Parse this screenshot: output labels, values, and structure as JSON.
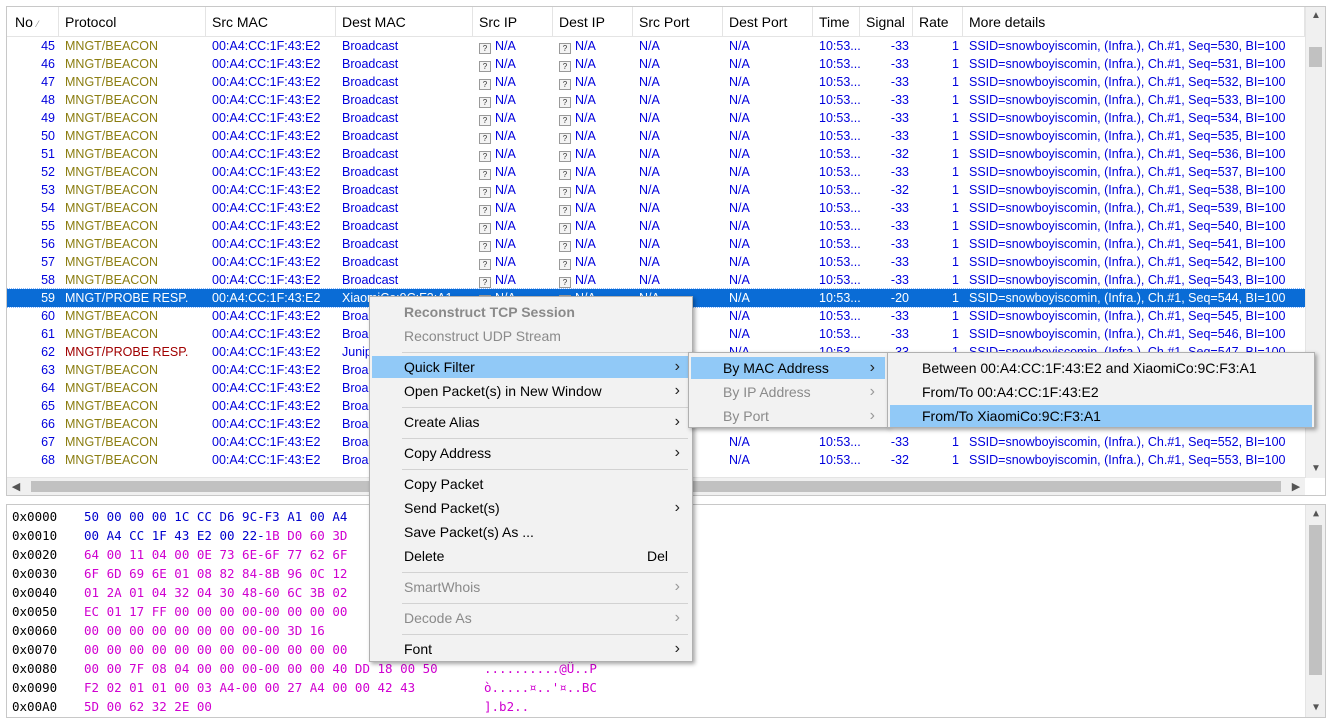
{
  "columns": [
    "No",
    "Protocol",
    "Src MAC",
    "Dest MAC",
    "Src IP",
    "Dest IP",
    "Src Port",
    "Dest Port",
    "Time",
    "Signal",
    "Rate",
    "More details"
  ],
  "rows": [
    {
      "no": "45",
      "protocol": "MNGT/BEACON",
      "src_mac": "00:A4:CC:1F:43:E2",
      "dest_mac": "Broadcast",
      "src_ip": "N/A",
      "dest_ip": "N/A",
      "src_port": "N/A",
      "dest_port": "N/A",
      "time": "10:53...",
      "signal": "-33",
      "rate": "1",
      "details": "SSID=snowboyiscomin, (Infra.), Ch.#1, Seq=530, BI=100"
    },
    {
      "no": "46",
      "protocol": "MNGT/BEACON",
      "src_mac": "00:A4:CC:1F:43:E2",
      "dest_mac": "Broadcast",
      "src_ip": "N/A",
      "dest_ip": "N/A",
      "src_port": "N/A",
      "dest_port": "N/A",
      "time": "10:53...",
      "signal": "-33",
      "rate": "1",
      "details": "SSID=snowboyiscomin, (Infra.), Ch.#1, Seq=531, BI=100"
    },
    {
      "no": "47",
      "protocol": "MNGT/BEACON",
      "src_mac": "00:A4:CC:1F:43:E2",
      "dest_mac": "Broadcast",
      "src_ip": "N/A",
      "dest_ip": "N/A",
      "src_port": "N/A",
      "dest_port": "N/A",
      "time": "10:53...",
      "signal": "-33",
      "rate": "1",
      "details": "SSID=snowboyiscomin, (Infra.), Ch.#1, Seq=532, BI=100"
    },
    {
      "no": "48",
      "protocol": "MNGT/BEACON",
      "src_mac": "00:A4:CC:1F:43:E2",
      "dest_mac": "Broadcast",
      "src_ip": "N/A",
      "dest_ip": "N/A",
      "src_port": "N/A",
      "dest_port": "N/A",
      "time": "10:53...",
      "signal": "-33",
      "rate": "1",
      "details": "SSID=snowboyiscomin, (Infra.), Ch.#1, Seq=533, BI=100"
    },
    {
      "no": "49",
      "protocol": "MNGT/BEACON",
      "src_mac": "00:A4:CC:1F:43:E2",
      "dest_mac": "Broadcast",
      "src_ip": "N/A",
      "dest_ip": "N/A",
      "src_port": "N/A",
      "dest_port": "N/A",
      "time": "10:53...",
      "signal": "-33",
      "rate": "1",
      "details": "SSID=snowboyiscomin, (Infra.), Ch.#1, Seq=534, BI=100"
    },
    {
      "no": "50",
      "protocol": "MNGT/BEACON",
      "src_mac": "00:A4:CC:1F:43:E2",
      "dest_mac": "Broadcast",
      "src_ip": "N/A",
      "dest_ip": "N/A",
      "src_port": "N/A",
      "dest_port": "N/A",
      "time": "10:53...",
      "signal": "-33",
      "rate": "1",
      "details": "SSID=snowboyiscomin, (Infra.), Ch.#1, Seq=535, BI=100"
    },
    {
      "no": "51",
      "protocol": "MNGT/BEACON",
      "src_mac": "00:A4:CC:1F:43:E2",
      "dest_mac": "Broadcast",
      "src_ip": "N/A",
      "dest_ip": "N/A",
      "src_port": "N/A",
      "dest_port": "N/A",
      "time": "10:53...",
      "signal": "-32",
      "rate": "1",
      "details": "SSID=snowboyiscomin, (Infra.), Ch.#1, Seq=536, BI=100"
    },
    {
      "no": "52",
      "protocol": "MNGT/BEACON",
      "src_mac": "00:A4:CC:1F:43:E2",
      "dest_mac": "Broadcast",
      "src_ip": "N/A",
      "dest_ip": "N/A",
      "src_port": "N/A",
      "dest_port": "N/A",
      "time": "10:53...",
      "signal": "-33",
      "rate": "1",
      "details": "SSID=snowboyiscomin, (Infra.), Ch.#1, Seq=537, BI=100"
    },
    {
      "no": "53",
      "protocol": "MNGT/BEACON",
      "src_mac": "00:A4:CC:1F:43:E2",
      "dest_mac": "Broadcast",
      "src_ip": "N/A",
      "dest_ip": "N/A",
      "src_port": "N/A",
      "dest_port": "N/A",
      "time": "10:53...",
      "signal": "-32",
      "rate": "1",
      "details": "SSID=snowboyiscomin, (Infra.), Ch.#1, Seq=538, BI=100"
    },
    {
      "no": "54",
      "protocol": "MNGT/BEACON",
      "src_mac": "00:A4:CC:1F:43:E2",
      "dest_mac": "Broadcast",
      "src_ip": "N/A",
      "dest_ip": "N/A",
      "src_port": "N/A",
      "dest_port": "N/A",
      "time": "10:53...",
      "signal": "-33",
      "rate": "1",
      "details": "SSID=snowboyiscomin, (Infra.), Ch.#1, Seq=539, BI=100"
    },
    {
      "no": "55",
      "protocol": "MNGT/BEACON",
      "src_mac": "00:A4:CC:1F:43:E2",
      "dest_mac": "Broadcast",
      "src_ip": "N/A",
      "dest_ip": "N/A",
      "src_port": "N/A",
      "dest_port": "N/A",
      "time": "10:53...",
      "signal": "-33",
      "rate": "1",
      "details": "SSID=snowboyiscomin, (Infra.), Ch.#1, Seq=540, BI=100"
    },
    {
      "no": "56",
      "protocol": "MNGT/BEACON",
      "src_mac": "00:A4:CC:1F:43:E2",
      "dest_mac": "Broadcast",
      "src_ip": "N/A",
      "dest_ip": "N/A",
      "src_port": "N/A",
      "dest_port": "N/A",
      "time": "10:53...",
      "signal": "-33",
      "rate": "1",
      "details": "SSID=snowboyiscomin, (Infra.), Ch.#1, Seq=541, BI=100"
    },
    {
      "no": "57",
      "protocol": "MNGT/BEACON",
      "src_mac": "00:A4:CC:1F:43:E2",
      "dest_mac": "Broadcast",
      "src_ip": "N/A",
      "dest_ip": "N/A",
      "src_port": "N/A",
      "dest_port": "N/A",
      "time": "10:53...",
      "signal": "-33",
      "rate": "1",
      "details": "SSID=snowboyiscomin, (Infra.), Ch.#1, Seq=542, BI=100"
    },
    {
      "no": "58",
      "protocol": "MNGT/BEACON",
      "src_mac": "00:A4:CC:1F:43:E2",
      "dest_mac": "Broadcast",
      "src_ip": "N/A",
      "dest_ip": "N/A",
      "src_port": "N/A",
      "dest_port": "N/A",
      "time": "10:53...",
      "signal": "-33",
      "rate": "1",
      "details": "SSID=snowboyiscomin, (Infra.), Ch.#1, Seq=543, BI=100"
    },
    {
      "no": "59",
      "protocol": "MNGT/PROBE RESP.",
      "src_mac": "00:A4:CC:1F:43:E2",
      "dest_mac": "XiaomiCo:9C:F3:A1",
      "src_ip": "N/A",
      "dest_ip": "N/A",
      "src_port": "N/A",
      "dest_port": "N/A",
      "time": "10:53...",
      "signal": "-20",
      "rate": "1",
      "details": "SSID=snowboyiscomin, (Infra.), Ch.#1, Seq=544, BI=100",
      "selected": true,
      "probe": true
    },
    {
      "no": "60",
      "protocol": "MNGT/BEACON",
      "src_mac": "00:A4:CC:1F:43:E2",
      "dest_mac": "Broa",
      "src_ip": "",
      "dest_ip": "",
      "src_port": "",
      "dest_port": "N/A",
      "time": "10:53...",
      "signal": "-33",
      "rate": "1",
      "details": "SSID=snowboyiscomin, (Infra.), Ch.#1, Seq=545, BI=100"
    },
    {
      "no": "61",
      "protocol": "MNGT/BEACON",
      "src_mac": "00:A4:CC:1F:43:E2",
      "dest_mac": "Broa",
      "src_ip": "",
      "dest_ip": "",
      "src_port": "",
      "dest_port": "N/A",
      "time": "10:53...",
      "signal": "-33",
      "rate": "1",
      "details": "SSID=snowboyiscomin, (Infra.), Ch.#1, Seq=546, BI=100"
    },
    {
      "no": "62",
      "protocol": "MNGT/PROBE RESP.",
      "src_mac": "00:A4:CC:1F:43:E2",
      "dest_mac": "Junip",
      "src_ip": "",
      "dest_ip": "",
      "src_port": "",
      "dest_port": "N/A",
      "time": "10:53...",
      "signal": "-33",
      "rate": "1",
      "details": "SSID=snowboyiscomin, (Infra.), Ch.#1, Seq=547, BI=100",
      "probe": true
    },
    {
      "no": "63",
      "protocol": "MNGT/BEACON",
      "src_mac": "00:A4:CC:1F:43:E2",
      "dest_mac": "Broa",
      "src_ip": "",
      "dest_ip": "",
      "src_port": "",
      "dest_port": "",
      "time": "",
      "signal": "",
      "rate": "",
      "details": ""
    },
    {
      "no": "64",
      "protocol": "MNGT/BEACON",
      "src_mac": "00:A4:CC:1F:43:E2",
      "dest_mac": "Broa",
      "src_ip": "",
      "dest_ip": "",
      "src_port": "",
      "dest_port": "",
      "time": "",
      "signal": "",
      "rate": "",
      "details": ""
    },
    {
      "no": "65",
      "protocol": "MNGT/BEACON",
      "src_mac": "00:A4:CC:1F:43:E2",
      "dest_mac": "Broa",
      "src_ip": "",
      "dest_ip": "",
      "src_port": "",
      "dest_port": "",
      "time": "",
      "signal": "",
      "rate": "",
      "details": ""
    },
    {
      "no": "66",
      "protocol": "MNGT/BEACON",
      "src_mac": "00:A4:CC:1F:43:E2",
      "dest_mac": "Broa",
      "src_ip": "",
      "dest_ip": "",
      "src_port": "",
      "dest_port": "",
      "time": "",
      "signal": "",
      "rate": "",
      "details": ""
    },
    {
      "no": "67",
      "protocol": "MNGT/BEACON",
      "src_mac": "00:A4:CC:1F:43:E2",
      "dest_mac": "Broa",
      "src_ip": "",
      "dest_ip": "",
      "src_port": "",
      "dest_port": "N/A",
      "time": "10:53...",
      "signal": "-33",
      "rate": "1",
      "details": "SSID=snowboyiscomin, (Infra.), Ch.#1, Seq=552, BI=100"
    },
    {
      "no": "68",
      "protocol": "MNGT/BEACON",
      "src_mac": "00:A4:CC:1F:43:E2",
      "dest_mac": "Broa",
      "src_ip": "",
      "dest_ip": "",
      "src_port": "",
      "dest_port": "N/A",
      "time": "10:53...",
      "signal": "-32",
      "rate": "1",
      "details": "SSID=snowboyiscomin, (Infra.), Ch.#1, Seq=553, BI=100"
    }
  ],
  "hex_dump": [
    {
      "offset": "0x0000",
      "bytes": [
        [
          "b",
          "50 00 00 00 1C CC D6 9C-F3 A1 00 A4"
        ]
      ],
      "ascii": ""
    },
    {
      "offset": "0x0010",
      "bytes": [
        [
          "b",
          "00 A4 CC 1F 43 E2 00 22-"
        ],
        [
          "m",
          "1B D0 60 3D"
        ]
      ],
      "ascii": ""
    },
    {
      "offset": "0x0020",
      "bytes": [
        [
          "m",
          "64 00 11 04 00 0E 73 6E-6F 77 62 6F"
        ]
      ],
      "ascii": ""
    },
    {
      "offset": "0x0030",
      "bytes": [
        [
          "m",
          "6F 6D 69 6E 01 08 82 84-8B 96 0C 12"
        ]
      ],
      "ascii": ""
    },
    {
      "offset": "0x0040",
      "bytes": [
        [
          "m",
          "01 2A 01 04 32 04 30 48-60 6C 3B 02"
        ]
      ],
      "ascii": ""
    },
    {
      "offset": "0x0050",
      "bytes": [
        [
          "m",
          "EC 01 17 FF 00 00 00 00-00 00 00 00"
        ]
      ],
      "ascii": ""
    },
    {
      "offset": "0x0060",
      "bytes": [
        [
          "m",
          "00 00 00 00 00 00 00 00-00 3D 16"
        ]
      ],
      "ascii": ""
    },
    {
      "offset": "0x0070",
      "bytes": [
        [
          "m",
          "00 00 00 00 00 00 00 00-00 00 00 00"
        ]
      ],
      "ascii": ""
    },
    {
      "offset": "0x0080",
      "bytes": [
        [
          "m",
          "00 00 7F 08 04 00 00 00-00 00 00 40 DD 18 00 50"
        ]
      ],
      "ascii": "..........@Ü..P"
    },
    {
      "offset": "0x0090",
      "bytes": [
        [
          "m",
          "F2 02 01 01 00 03 A4-00 00 27 A4 00 00 42 43"
        ]
      ],
      "ascii": "ò.....¤..'¤..BC"
    },
    {
      "offset": "0x00A0",
      "bytes": [
        [
          "m",
          "5D 00 62 32 2E 00"
        ]
      ],
      "ascii": "].b2.."
    }
  ],
  "context_menu": {
    "items": [
      {
        "label": "Reconstruct TCP Session",
        "disabled": true,
        "bold": true
      },
      {
        "label": "Reconstruct UDP Stream",
        "disabled": true
      },
      {
        "sep": true
      },
      {
        "label": "Quick Filter",
        "submenu": true,
        "highlighted": true
      },
      {
        "label": "Open Packet(s) in New Window",
        "submenu": true
      },
      {
        "sep": true
      },
      {
        "label": "Create Alias",
        "submenu": true
      },
      {
        "sep": true
      },
      {
        "label": "Copy Address",
        "submenu": true
      },
      {
        "sep": true
      },
      {
        "label": "Copy Packet"
      },
      {
        "label": "Send Packet(s)",
        "submenu": true
      },
      {
        "label": "Save Packet(s) As ..."
      },
      {
        "label": "Delete",
        "shortcut": "Del"
      },
      {
        "sep": true
      },
      {
        "label": "SmartWhois",
        "submenu": true,
        "disabled": true
      },
      {
        "sep": true
      },
      {
        "label": "Decode As",
        "submenu": true,
        "disabled": true
      },
      {
        "sep": true
      },
      {
        "label": "Font",
        "submenu": true
      }
    ]
  },
  "quick_filter_menu": {
    "items": [
      {
        "label": "By MAC Address",
        "submenu": true,
        "highlighted": true
      },
      {
        "label": "By IP Address",
        "submenu": true,
        "disabled": true
      },
      {
        "label": "By Port",
        "submenu": true,
        "disabled": true
      }
    ]
  },
  "mac_filter_menu": {
    "items": [
      {
        "label": "Between 00:A4:CC:1F:43:E2 and XiaomiCo:9C:F3:A1"
      },
      {
        "label": "From/To 00:A4:CC:1F:43:E2"
      },
      {
        "label": "From/To XiaomiCo:9C:F3:A1",
        "highlighted": true
      }
    ]
  },
  "colors": {
    "selection": "#0a6cd6",
    "menu_highlight": "#91c9f7",
    "beacon_protocol": "#8b7d10",
    "probe_protocol": "#a00000",
    "address_text": "#0000dd",
    "hex_payload": "#d000d0"
  },
  "icons": {
    "unknown_ip": "question-box-icon",
    "sort": "sort-indicator-icon",
    "submenu": "chevron-right-icon"
  }
}
